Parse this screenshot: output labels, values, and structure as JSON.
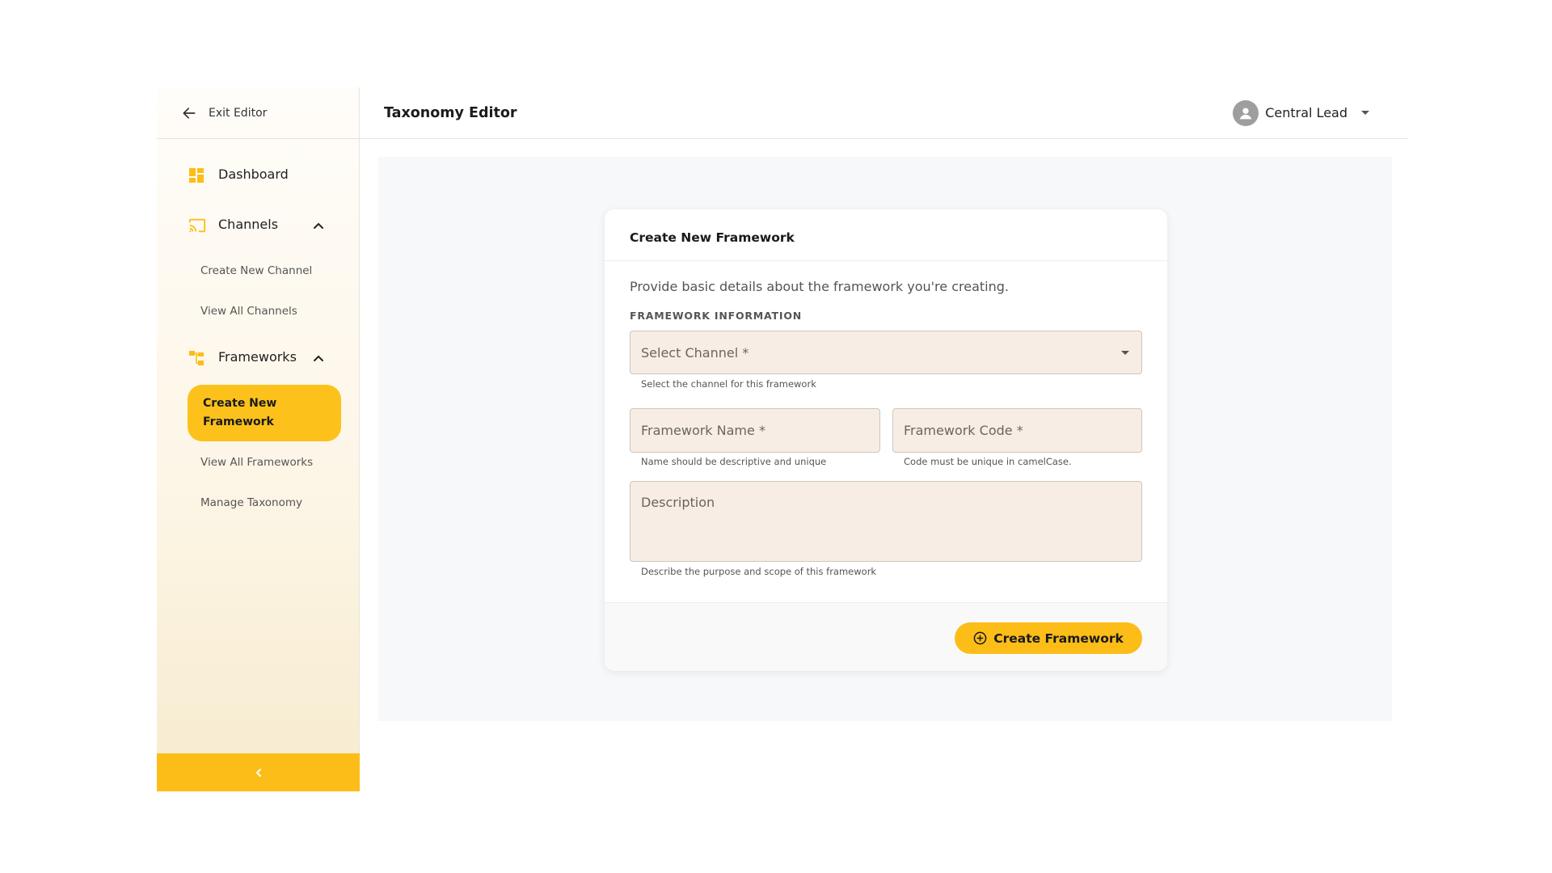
{
  "sidebar": {
    "exit_label": "Exit Editor",
    "dashboard_label": "Dashboard",
    "channels_label": "Channels",
    "channels_items": [
      "Create New Channel",
      "View All Channels"
    ],
    "frameworks_label": "Frameworks",
    "frameworks_active": "Create New Framework",
    "frameworks_items": [
      "View All Frameworks",
      "Manage Taxonomy"
    ]
  },
  "header": {
    "title": "Taxonomy Editor",
    "user_name": "Central Lead"
  },
  "form": {
    "card_title": "Create New Framework",
    "intro": "Provide basic details about the framework you're creating.",
    "section_label": "FRAMEWORK INFORMATION",
    "channel_placeholder": "Select Channel *",
    "channel_help": "Select the channel for this framework",
    "name_placeholder": "Framework Name *",
    "name_help": "Name should be descriptive and unique",
    "code_placeholder": "Framework Code *",
    "code_help": "Code must be unique in camelCase.",
    "description_placeholder": "Description",
    "description_help": "Describe the purpose and scope of this framework",
    "submit_label": "Create Framework"
  },
  "icons": {
    "exit": "arrow-left-icon",
    "dashboard": "dashboard-icon",
    "channels": "cast-icon",
    "frameworks": "hierarchy-icon",
    "expand": "chevron-up-icon",
    "collapse": "chevron-left-icon",
    "user": "user-avatar-icon",
    "user_menu": "caret-down-icon",
    "select": "caret-down-icon",
    "submit": "plus-circle-icon"
  },
  "colors": {
    "accent": "#fcbd19",
    "field_bg": "#f7ede4",
    "content_bg": "#f7f8fa"
  }
}
